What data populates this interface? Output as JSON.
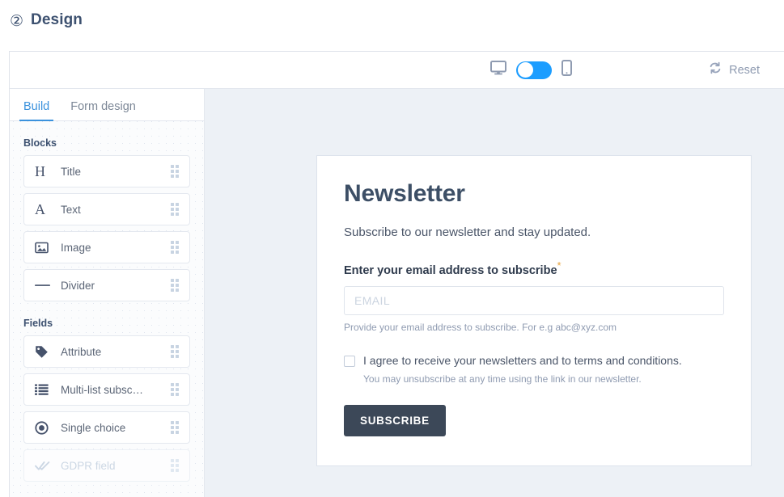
{
  "header": {
    "step_marker": "②",
    "title": "Design"
  },
  "toolbar": {
    "desktop_icon": "monitor-icon",
    "mobile_icon": "phone-icon",
    "device_toggle_state": "desktop",
    "reset_icon": "loop-arrows-icon",
    "reset_label": "Reset"
  },
  "sidebar": {
    "tabs": [
      {
        "label": "Build",
        "active": true
      },
      {
        "label": "Form design",
        "active": false
      }
    ],
    "groups": [
      {
        "label": "Blocks",
        "items": [
          {
            "label": "Title",
            "icon": "heading-h-icon",
            "disabled": false
          },
          {
            "label": "Text",
            "icon": "text-a-icon",
            "disabled": false
          },
          {
            "label": "Image",
            "icon": "image-icon",
            "disabled": false
          },
          {
            "label": "Divider",
            "icon": "divider-line-icon",
            "disabled": false
          }
        ]
      },
      {
        "label": "Fields",
        "items": [
          {
            "label": "Attribute",
            "icon": "tag-icon",
            "disabled": false
          },
          {
            "label": "Multi-list subsc…",
            "icon": "list-icon",
            "disabled": false
          },
          {
            "label": "Single choice",
            "icon": "radio-target-icon",
            "disabled": false
          },
          {
            "label": "GDPR field",
            "icon": "double-check-icon",
            "disabled": true
          }
        ]
      }
    ],
    "drag_handle_icon": "drag-grip-icon"
  },
  "preview": {
    "form": {
      "title": "Newsletter",
      "subtitle": "Subscribe to our newsletter and stay updated.",
      "email_label": "Enter your email address to subscribe",
      "required_marker": "*",
      "email_placeholder": "EMAIL",
      "email_value": "",
      "email_helper": "Provide your email address to subscribe. For e.g abc@xyz.com",
      "consent_text": "I agree to receive your newsletters and to terms and conditions.",
      "consent_checked": false,
      "consent_note": "You may unsubscribe at any time using the link in our newsletter.",
      "submit_label": "SUBSCRIBE"
    }
  },
  "colors": {
    "accent_blue": "#3b92dd",
    "toggle_blue": "#1c9dff",
    "heading_navy": "#3d5170",
    "button_dark": "#3c4858",
    "required_orange": "#e8a33d",
    "preview_bg": "#edf1f6"
  }
}
